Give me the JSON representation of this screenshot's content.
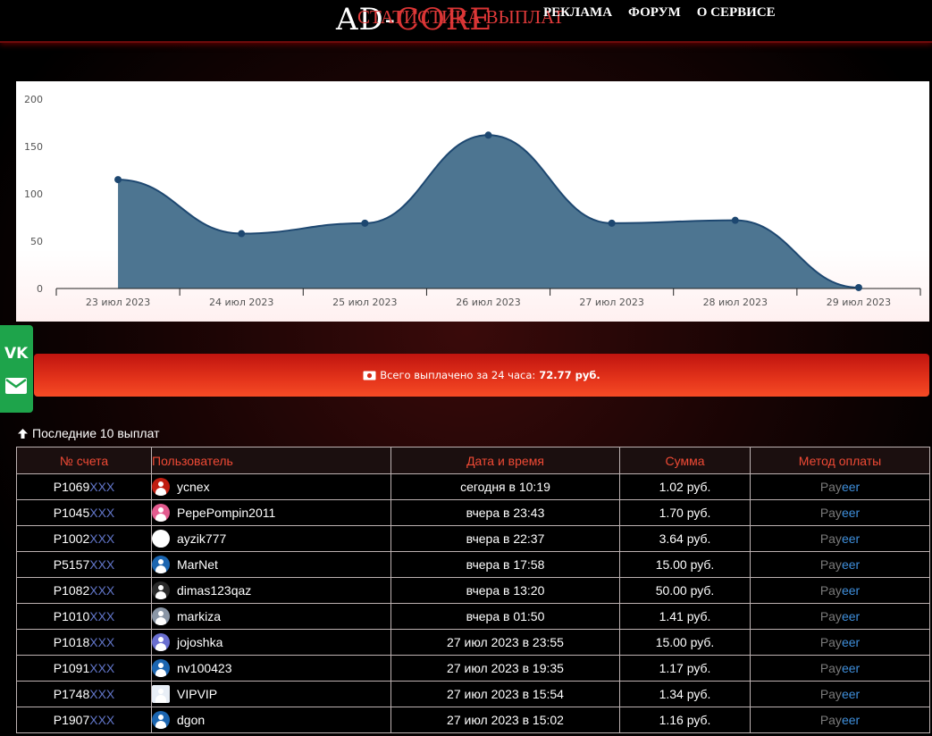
{
  "header": {
    "logo_left": "AD-",
    "logo_right": "CORE",
    "heading": "Статистика выплат",
    "nav": [
      "РЕКЛАМА",
      "ФОРУМ",
      "О СЕРВИСЕ"
    ]
  },
  "chart_data": {
    "type": "area",
    "title": "",
    "xlabel": "",
    "ylabel": "",
    "categories": [
      "23 июл 2023",
      "24 июл 2023",
      "25 июл 2023",
      "26 июл 2023",
      "27 июл 2023",
      "28 июл 2023",
      "29 июл 2023"
    ],
    "values": [
      115,
      58,
      69,
      162,
      69,
      72,
      1
    ],
    "yticks": [
      0,
      50,
      100,
      150,
      200
    ],
    "ylim": [
      0,
      200
    ],
    "grid": false,
    "legend": "none",
    "colors": {
      "fill": "#4d7591",
      "line": "#1d4770",
      "point": "#1d4770"
    }
  },
  "social": {
    "icons": [
      "vk-icon",
      "mail-icon"
    ],
    "color": "#1ea44b"
  },
  "banner": {
    "text": "Всего выплачено за 24 часа:",
    "amount": "72.77 руб."
  },
  "section": {
    "title": "Последние 10 выплат"
  },
  "table": {
    "headers": [
      "№ счета",
      "Пользователь",
      "Дата и время",
      "Сумма",
      "Метод оплаты"
    ],
    "rows": [
      {
        "account": "P1069",
        "suffix": "XXX",
        "user": "ycnex",
        "avatar": "av-red",
        "date": "сегодня в 10:19",
        "sum": "1.02 руб.",
        "method_a": "Pay",
        "method_b": "eer"
      },
      {
        "account": "P1045",
        "suffix": "XXX",
        "user": "PepePompin2011",
        "avatar": "av-pink",
        "date": "вчера в 23:43",
        "sum": "1.70 руб.",
        "method_a": "Pay",
        "method_b": "eer"
      },
      {
        "account": "P1002",
        "suffix": "XXX",
        "user": "ayzik777",
        "avatar": "av-star",
        "date": "вчера в 22:37",
        "sum": "3.64 руб.",
        "method_a": "Pay",
        "method_b": "eer"
      },
      {
        "account": "P5157",
        "suffix": "XXX",
        "user": "MarNet",
        "avatar": "av-blue",
        "date": "вчера в 17:58",
        "sum": "15.00 руб.",
        "method_a": "Pay",
        "method_b": "eer"
      },
      {
        "account": "P1082",
        "suffix": "XXX",
        "user": "dimas123qaz",
        "avatar": "av-dark",
        "date": "вчера в 13:20",
        "sum": "50.00 руб.",
        "method_a": "Pay",
        "method_b": "eer"
      },
      {
        "account": "P1010",
        "suffix": "XXX",
        "user": "markiza",
        "avatar": "av-grey",
        "date": "вчера в 01:50",
        "sum": "1.41 руб.",
        "method_a": "Pay",
        "method_b": "eer"
      },
      {
        "account": "P1018",
        "suffix": "XXX",
        "user": "jojoshka",
        "avatar": "av-purple",
        "date": "27 июл 2023 в 23:55",
        "sum": "15.00 руб.",
        "method_a": "Pay",
        "method_b": "eer"
      },
      {
        "account": "P1091",
        "suffix": "XXX",
        "user": "nv100423",
        "avatar": "av-blue",
        "date": "27 июл 2023 в 19:35",
        "sum": "1.17 руб.",
        "method_a": "Pay",
        "method_b": "eer"
      },
      {
        "account": "P1748",
        "suffix": "XXX",
        "user": "VIPVIP",
        "avatar": "av-white",
        "date": "27 июл 2023 в 15:54",
        "sum": "1.34 руб.",
        "method_a": "Pay",
        "method_b": "eer"
      },
      {
        "account": "P1907",
        "suffix": "XXX",
        "user": "dgon",
        "avatar": "av-blue",
        "date": "27 июл 2023 в 15:02",
        "sum": "1.16 руб.",
        "method_a": "Pay",
        "method_b": "eer"
      }
    ]
  }
}
